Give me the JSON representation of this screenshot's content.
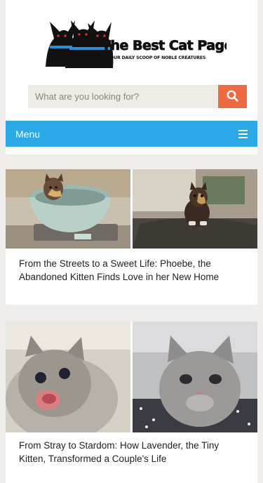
{
  "site": {
    "logo_title": "The Best Cat Page",
    "logo_tagline": "YOUR DAILY SCOOP OF NOBLE CREATURES"
  },
  "search": {
    "placeholder": "What are you looking for?",
    "button_icon": "search-icon"
  },
  "menu": {
    "label": "Menu",
    "icon": "hamburger-icon"
  },
  "articles": [
    {
      "title": "From the Streets to a Sweet Life: Phoebe, the Abandoned Kitten Finds Love in her New Home"
    },
    {
      "title": "From Stray to Stardom: How Lavender, the Tiny Kitten, Transformed a Couple's Life"
    }
  ],
  "colors": {
    "accent": "#2aa9e6",
    "search_button": "#ed6a43",
    "background": "#f0eeec"
  }
}
